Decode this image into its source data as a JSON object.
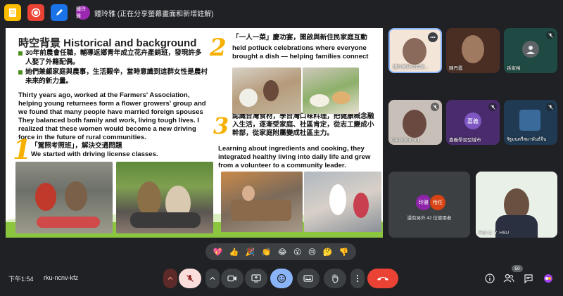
{
  "topbar": {
    "presenter_initials": "鍾玲雅",
    "presenter_status": "鍾玲雅 (正在分享螢幕畫面和新增註解)"
  },
  "slide": {
    "title": "時空背景 Historical and background",
    "num1": "1",
    "num2": "2",
    "num3": "3",
    "bullets": [
      "30年前農會任職，輔導返鄉青年成立花卉產銷班，發現許多人娶了外籍配偶。",
      "她們兼顧家庭與農事，生活艱辛，當時意識到這群女性是農村未來的新力量。"
    ],
    "en_para1": "Thirty years ago, worked at the Farmers' Association, helping young returnees form a flower growers' group and we found that many people have married foreign spouses They balanced both family and work, living tough lives. I realized that these women would become a new driving force in the future of rural communities.",
    "sec1_zh": "「駕照考照班」，解決交通問題",
    "sec1_en": "We started with driving license classes.",
    "sec2_zh": "「一人一菜」慶功宴，開啟與新住民家庭互動",
    "sec2_en": "held potluck celebrations where everyone brought a dish — helping families connect",
    "sec3_zh": "認識台灣食材，學台灣口味料理，把健康概念融入生活，逐漸受家庭、社區肯定，從志工變成小幹部，從家庭附屬變成社區主力。",
    "sec3_en": "Learning about ingredients and cooking, they integrated healthy living into daily life and grew from a volunteer to a community leader."
  },
  "participants": [
    {
      "name": "鍾玲雅新住民家..."
    },
    {
      "name": "陳丹霞"
    },
    {
      "name": "孫家榕"
    },
    {
      "name": "Darinthorn Int..."
    },
    {
      "name": "嘉義學習型城市",
      "avatar": "嘉義"
    },
    {
      "name": "รัฐมนตรีสมาพันธ์จีน"
    },
    {
      "name": "還有另外 42 位使用者",
      "avatars": [
        "玲雅",
        "怡任"
      ]
    },
    {
      "name": "Fish C. Y. HSU"
    }
  ],
  "reactions": [
    "💖",
    "👍",
    "🎉",
    "👏",
    "😂",
    "😮",
    "😢",
    "🤔",
    "👎"
  ],
  "bottom": {
    "clock": "下午1:54",
    "meeting_code": "rku-ncnv-kfz",
    "people_count": "50"
  },
  "colors": {
    "bg": "#202124",
    "accent_red": "#ea4335",
    "slide_green": "#8cc63f",
    "number_yellow": "#f7b000"
  },
  "icons": {
    "top": [
      "notes-icon",
      "record-icon",
      "whiteboard-icon"
    ],
    "controls": [
      "mic-off-icon",
      "camera-icon",
      "present-icon",
      "emoji-icon",
      "captions-icon",
      "raise-hand-icon",
      "more-icon",
      "leave-call-icon"
    ],
    "right": [
      "info-icon",
      "people-icon",
      "chat-icon",
      "activities-icon"
    ]
  }
}
